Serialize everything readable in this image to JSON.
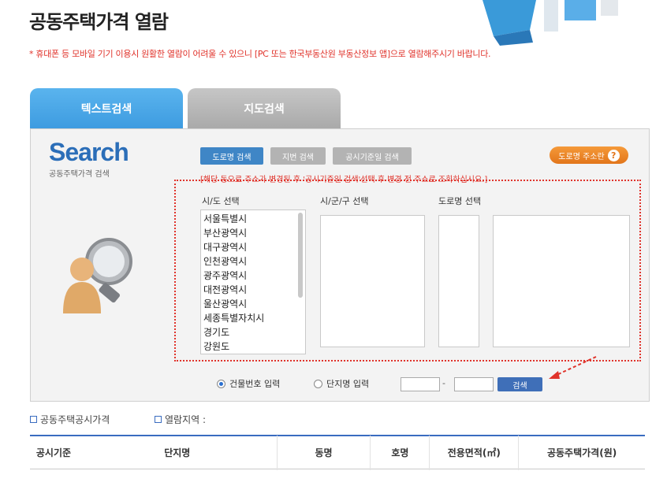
{
  "page": {
    "title": "공동주택가격 열람",
    "notice": "* 휴대폰 등 모바일 기기 이용시 원활한 열람이 어려울 수 있으니 [PC 또는 한국부동산원 부동산정보 앱]으로 열람해주시기 바랍니다."
  },
  "tabs": [
    {
      "label": "텍스트검색",
      "active": true
    },
    {
      "label": "지도검색",
      "active": false
    }
  ],
  "search_panel": {
    "logo": "Search",
    "logo_sub": "공동주택가격 검색",
    "buttons": {
      "road": "도로명 검색",
      "lot": "지번 검색",
      "date": "공시기준일 검색",
      "help": "도로명 주소란"
    },
    "help_icon": "?",
    "hint": "[해당 동으로 주소가 변경된 후 '공시기준일 검색'선택 후 변경 전 주소로 조회하십시오.]",
    "columns": {
      "sido": "시/도 선택",
      "sigungu": "시/군/구 선택",
      "road": "도로명 선택"
    },
    "sido_options": [
      "서울특별시",
      "부산광역시",
      "대구광역시",
      "인천광역시",
      "광주광역시",
      "대전광역시",
      "울산광역시",
      "세종특별자치시",
      "경기도",
      "강원도"
    ],
    "radios": [
      {
        "label": "건물번호 입력",
        "checked": true
      },
      {
        "label": "단지명 입력",
        "checked": false
      }
    ],
    "dash": "-",
    "search_label": "검색"
  },
  "crumbs": {
    "left": "공동주택공시가격",
    "right": "열람지역 :"
  },
  "table": {
    "headers": [
      "공시기준",
      "단지명",
      "동명",
      "호명",
      "전용면적(㎡)",
      "공동주택가격(원)"
    ]
  },
  "colors": {
    "accent_red": "#e0332b",
    "tab_blue": "#3d9be0",
    "button_blue": "#3f86c6",
    "help_orange": "#e2751a"
  }
}
